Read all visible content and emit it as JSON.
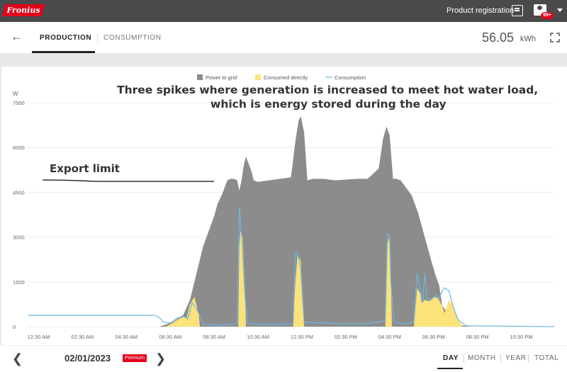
{
  "header": {
    "brand": "Fronius",
    "product_registration": "Product registration",
    "notification_count": "99+"
  },
  "tabs": [
    {
      "label": "PRODUCTION",
      "active": true
    },
    {
      "label": "CONSUMPTION",
      "active": false
    }
  ],
  "summary": {
    "energy_value": "56.05",
    "energy_unit": "kWh"
  },
  "footer": {
    "date": "02/01/2023",
    "premium_badge": "Premium",
    "periods": [
      "DAY",
      "MONTH",
      "YEAR",
      "TOTAL"
    ],
    "active_period": "DAY"
  },
  "annotations": {
    "spikes_line1": "Three spikes where generation is increased to meet hot water load,",
    "spikes_line2": "which is energy stored during the day",
    "export_limit": "Export limit"
  },
  "colors": {
    "power_to_grid": "#8c8c8c",
    "consumed_directly": "#fce27a",
    "consumption": "#6fb6e3",
    "brand": "#e2001a"
  },
  "chart_data": {
    "type": "area",
    "title": "",
    "ylabel": "W",
    "ylim": [
      0,
      7500
    ],
    "yticks": [
      0,
      1500,
      3000,
      4500,
      6000,
      7500
    ],
    "xlim": [
      0,
      24
    ],
    "xticks": [
      {
        "label": "12:30 AM",
        "hour": 0.5
      },
      {
        "label": "02:30 AM",
        "hour": 2.5
      },
      {
        "label": "04:30 AM",
        "hour": 4.5
      },
      {
        "label": "06:30 AM",
        "hour": 6.5
      },
      {
        "label": "08:30 AM",
        "hour": 8.5
      },
      {
        "label": "10:30 AM",
        "hour": 10.5
      },
      {
        "label": "12:30 PM",
        "hour": 12.5
      },
      {
        "label": "02:30 PM",
        "hour": 14.5
      },
      {
        "label": "04:30 PM",
        "hour": 16.5
      },
      {
        "label": "06:30 PM",
        "hour": 18.5
      },
      {
        "label": "08:30 PM",
        "hour": 20.5
      },
      {
        "label": "10:30 PM",
        "hour": 22.5
      }
    ],
    "legend_position": "top-center",
    "series": [
      {
        "name": "Power to grid",
        "kind": "area",
        "x": [
          6.0,
          6.6,
          7.1,
          7.4,
          7.7,
          8.0,
          8.3,
          8.5,
          8.65,
          8.9,
          9.1,
          9.25,
          9.4,
          9.55,
          9.65,
          9.75,
          9.85,
          9.95,
          10.1,
          10.2,
          10.3,
          10.5,
          11.0,
          11.5,
          12.0,
          12.2,
          12.35,
          12.45,
          12.6,
          12.75,
          13.0,
          13.5,
          14.0,
          15.0,
          15.5,
          16.0,
          16.2,
          16.35,
          16.5,
          16.65,
          16.8,
          17.0,
          17.5,
          17.8,
          18.1,
          18.4,
          18.6,
          18.75,
          18.9,
          19.1,
          19.3,
          19.5,
          19.8,
          20.2
        ],
        "y": [
          0,
          150,
          400,
          900,
          1800,
          2700,
          3300,
          3700,
          4100,
          4500,
          4900,
          4950,
          4950,
          4900,
          4550,
          4900,
          5400,
          5700,
          5400,
          5200,
          4900,
          4850,
          4900,
          4950,
          5000,
          6200,
          6900,
          7050,
          6500,
          4900,
          4950,
          4950,
          4900,
          4950,
          4950,
          5300,
          6300,
          6700,
          6400,
          4950,
          4950,
          4900,
          4400,
          3800,
          3000,
          2200,
          1700,
          1400,
          700,
          500,
          300,
          150,
          40,
          0
        ]
      },
      {
        "name": "Consumed directly",
        "kind": "area",
        "x": [
          6.3,
          6.6,
          6.9,
          7.1,
          7.25,
          7.4,
          7.6,
          7.8,
          7.85,
          9.6,
          9.65,
          9.7,
          9.8,
          9.9,
          9.95,
          12.1,
          12.2,
          12.3,
          12.45,
          12.6,
          16.3,
          16.4,
          16.5,
          16.55,
          16.6,
          17.6,
          17.75,
          17.9,
          17.95,
          18.1,
          18.3,
          18.5,
          18.7,
          18.9,
          19.0,
          19.2,
          19.4,
          19.6,
          19.8
        ],
        "y": [
          0,
          120,
          260,
          330,
          300,
          750,
          1000,
          400,
          0,
          0,
          2700,
          3200,
          3000,
          1300,
          0,
          0,
          1500,
          2400,
          2200,
          0,
          0,
          2800,
          3000,
          2000,
          0,
          0,
          1300,
          1100,
          800,
          900,
          850,
          1000,
          950,
          700,
          450,
          900,
          700,
          300,
          0
        ]
      },
      {
        "name": "Consumption",
        "kind": "line",
        "x": [
          0,
          5.8,
          6.0,
          6.2,
          6.5,
          6.8,
          7.1,
          7.3,
          7.5,
          7.7,
          8.0,
          8.5,
          9.0,
          9.55,
          9.65,
          9.75,
          9.9,
          10.0,
          10.5,
          11.5,
          12.1,
          12.2,
          12.3,
          12.45,
          12.6,
          13.5,
          14.5,
          15.5,
          16.3,
          16.4,
          16.5,
          16.55,
          16.7,
          17.3,
          17.6,
          17.75,
          17.9,
          18.0,
          18.1,
          18.2,
          18.4,
          18.6,
          18.75,
          18.9,
          19.0,
          19.2,
          19.4,
          19.6,
          19.8,
          20.0,
          24
        ],
        "y": [
          380,
          380,
          300,
          150,
          120,
          280,
          350,
          250,
          800,
          600,
          80,
          60,
          60,
          100,
          4000,
          3100,
          1100,
          100,
          80,
          80,
          100,
          2400,
          2500,
          1900,
          150,
          120,
          100,
          100,
          200,
          3100,
          3000,
          1500,
          150,
          100,
          150,
          1800,
          1200,
          800,
          1800,
          950,
          900,
          1050,
          950,
          1200,
          1300,
          1200,
          650,
          250,
          120,
          30,
          0
        ]
      }
    ]
  }
}
